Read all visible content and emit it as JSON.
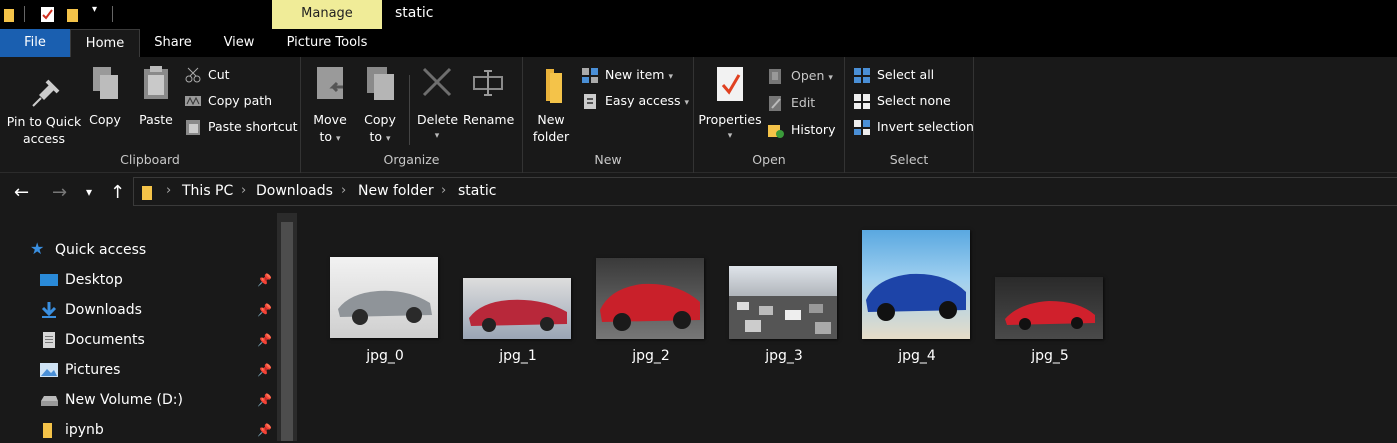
{
  "window": {
    "title": "static",
    "contextual_tab": "Manage"
  },
  "tabs": {
    "file": "File",
    "home": "Home",
    "share": "Share",
    "view": "View",
    "picture_tools": "Picture Tools"
  },
  "ribbon": {
    "clipboard": {
      "pin": "Pin to Quick access",
      "pin_l1": "Pin to Quick",
      "pin_l2": "access",
      "copy": "Copy",
      "paste": "Paste",
      "cut": "Cut",
      "copy_path": "Copy path",
      "paste_shortcut": "Paste shortcut",
      "label": "Clipboard"
    },
    "organize": {
      "move_to_l1": "Move",
      "move_to_l2": "to",
      "copy_to_l1": "Copy",
      "copy_to_l2": "to",
      "delete": "Delete",
      "rename": "Rename",
      "label": "Organize"
    },
    "new": {
      "new_folder_l1": "New",
      "new_folder_l2": "folder",
      "new_item": "New item",
      "easy_access": "Easy access",
      "label": "New"
    },
    "open": {
      "properties": "Properties",
      "open": "Open",
      "edit": "Edit",
      "history": "History",
      "label": "Open"
    },
    "select": {
      "select_all": "Select all",
      "select_none": "Select none",
      "invert": "Invert selection",
      "label": "Select"
    }
  },
  "breadcrumb": [
    "This PC",
    "Downloads",
    "New folder",
    "static"
  ],
  "nav": {
    "quick_access": "Quick access",
    "items": [
      {
        "label": "Desktop"
      },
      {
        "label": "Downloads"
      },
      {
        "label": "Documents"
      },
      {
        "label": "Pictures"
      },
      {
        "label": "New Volume (D:)"
      },
      {
        "label": "ipynb"
      }
    ]
  },
  "files": [
    {
      "name": "jpg_0",
      "color": "#c9c9c9"
    },
    {
      "name": "jpg_1",
      "color": "#b8283a"
    },
    {
      "name": "jpg_2",
      "color": "#c9202a"
    },
    {
      "name": "jpg_3",
      "color": "#8a8a8a"
    },
    {
      "name": "jpg_4",
      "color": "#1d44a8"
    },
    {
      "name": "jpg_5",
      "color": "#d0202c"
    }
  ],
  "colors": {
    "accent": "#1a5fb0",
    "manage_tab": "#f0ec98",
    "folder": "#f4c349"
  }
}
